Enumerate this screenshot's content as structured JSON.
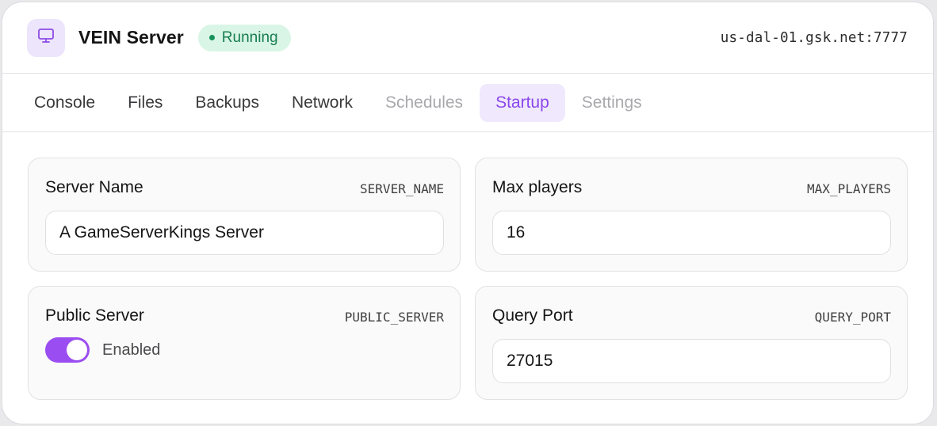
{
  "header": {
    "server_icon": "monitor-icon",
    "title": "VEIN Server",
    "status": "Running",
    "status_color": "#17915a",
    "address": "us-dal-01.gsk.net:7777"
  },
  "tabs": [
    {
      "label": "Console",
      "state": "normal"
    },
    {
      "label": "Files",
      "state": "normal"
    },
    {
      "label": "Backups",
      "state": "normal"
    },
    {
      "label": "Network",
      "state": "normal"
    },
    {
      "label": "Schedules",
      "state": "disabled"
    },
    {
      "label": "Startup",
      "state": "active"
    },
    {
      "label": "Settings",
      "state": "disabled"
    }
  ],
  "variables": {
    "server_name": {
      "label": "Server Name",
      "env": "SERVER_NAME",
      "value": "A GameServerKings Server"
    },
    "max_players": {
      "label": "Max players",
      "env": "MAX_PLAYERS",
      "value": "16"
    },
    "public_server": {
      "label": "Public Server",
      "env": "PUBLIC_SERVER",
      "enabled": true,
      "state_label": "Enabled"
    },
    "query_port": {
      "label": "Query Port",
      "env": "QUERY_PORT",
      "value": "27015"
    }
  },
  "colors": {
    "accent": "#9a4df0",
    "accent_soft": "#f0e9fd"
  }
}
